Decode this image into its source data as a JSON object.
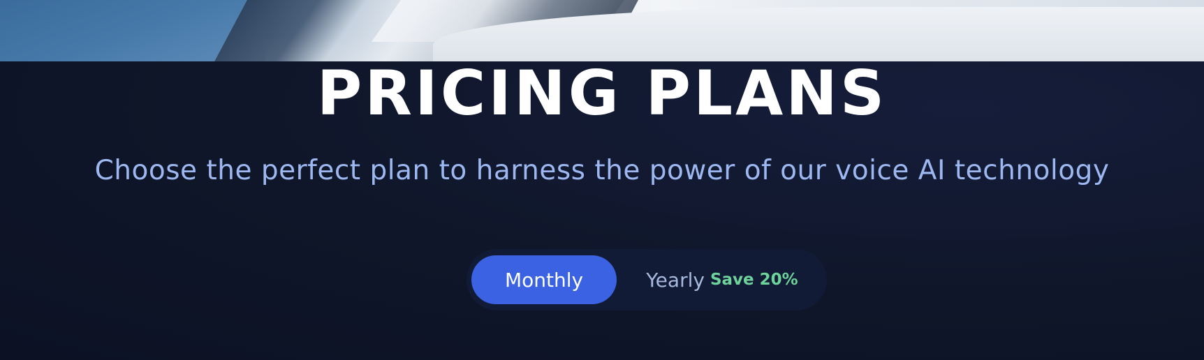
{
  "hero": {
    "image_alt": "snowy-mountain-lake-photo"
  },
  "header": {
    "title": "PRICING PLANS",
    "subtitle": "Choose the perfect plan to harness the power of our voice AI technology"
  },
  "billing_toggle": {
    "options": [
      {
        "label": "Monthly",
        "selected": true
      },
      {
        "label": "Yearly",
        "badge": "Save 20%",
        "selected": false
      }
    ]
  },
  "colors": {
    "background": "#0f1629",
    "accent": "#3a62e3",
    "subtitle": "#9db8f0",
    "badge": "#6ed39a"
  }
}
